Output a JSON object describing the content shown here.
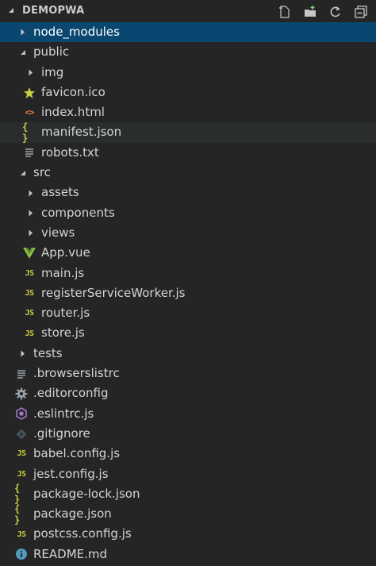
{
  "explorer": {
    "title": "DEMOPWA",
    "actions": [
      {
        "name": "new-file-icon"
      },
      {
        "name": "new-folder-icon"
      },
      {
        "name": "refresh-icon"
      },
      {
        "name": "collapse-all-icon"
      }
    ]
  },
  "tree": [
    {
      "label": "node_modules",
      "type": "folder",
      "expanded": false,
      "depth": 0,
      "state": "selected"
    },
    {
      "label": "public",
      "type": "folder",
      "expanded": true,
      "depth": 0
    },
    {
      "label": "img",
      "type": "folder",
      "expanded": false,
      "depth": 1
    },
    {
      "label": "favicon.ico",
      "type": "file",
      "icon": "star-icon",
      "depth": 1
    },
    {
      "label": "index.html",
      "type": "file",
      "icon": "html-icon",
      "depth": 1
    },
    {
      "label": "manifest.json",
      "type": "file",
      "icon": "json-icon",
      "depth": 1,
      "state": "hovered"
    },
    {
      "label": "robots.txt",
      "type": "file",
      "icon": "text-file-icon",
      "depth": 1
    },
    {
      "label": "src",
      "type": "folder",
      "expanded": true,
      "depth": 0
    },
    {
      "label": "assets",
      "type": "folder",
      "expanded": false,
      "depth": 1
    },
    {
      "label": "components",
      "type": "folder",
      "expanded": false,
      "depth": 1
    },
    {
      "label": "views",
      "type": "folder",
      "expanded": false,
      "depth": 1
    },
    {
      "label": "App.vue",
      "type": "file",
      "icon": "vue-icon",
      "depth": 1
    },
    {
      "label": "main.js",
      "type": "file",
      "icon": "js-icon",
      "depth": 1
    },
    {
      "label": "registerServiceWorker.js",
      "type": "file",
      "icon": "js-icon",
      "depth": 1
    },
    {
      "label": "router.js",
      "type": "file",
      "icon": "js-icon",
      "depth": 1
    },
    {
      "label": "store.js",
      "type": "file",
      "icon": "js-icon",
      "depth": 1
    },
    {
      "label": "tests",
      "type": "folder",
      "expanded": false,
      "depth": 0
    },
    {
      "label": ".browserslistrc",
      "type": "file",
      "icon": "text-file-icon",
      "depth": 0
    },
    {
      "label": ".editorconfig",
      "type": "file",
      "icon": "gear-icon",
      "depth": 0
    },
    {
      "label": ".eslintrc.js",
      "type": "file",
      "icon": "eslint-icon",
      "depth": 0
    },
    {
      "label": ".gitignore",
      "type": "file",
      "icon": "git-icon",
      "depth": 0
    },
    {
      "label": "babel.config.js",
      "type": "file",
      "icon": "js-icon",
      "depth": 0
    },
    {
      "label": "jest.config.js",
      "type": "file",
      "icon": "js-icon",
      "depth": 0
    },
    {
      "label": "package-lock.json",
      "type": "file",
      "icon": "json-icon",
      "depth": 0
    },
    {
      "label": "package.json",
      "type": "file",
      "icon": "json-icon",
      "depth": 0
    },
    {
      "label": "postcss.config.js",
      "type": "file",
      "icon": "js-icon",
      "depth": 0
    },
    {
      "label": "README.md",
      "type": "file",
      "icon": "info-icon",
      "depth": 0
    }
  ],
  "colors": {
    "background": "#252526",
    "selected": "#094771",
    "hover": "#2a2d2e",
    "js": "#cbcb41",
    "html": "#e37933",
    "vue": "#8dc149",
    "eslint": "#a074c4",
    "info": "#519aba",
    "muted": "#6d8086"
  }
}
